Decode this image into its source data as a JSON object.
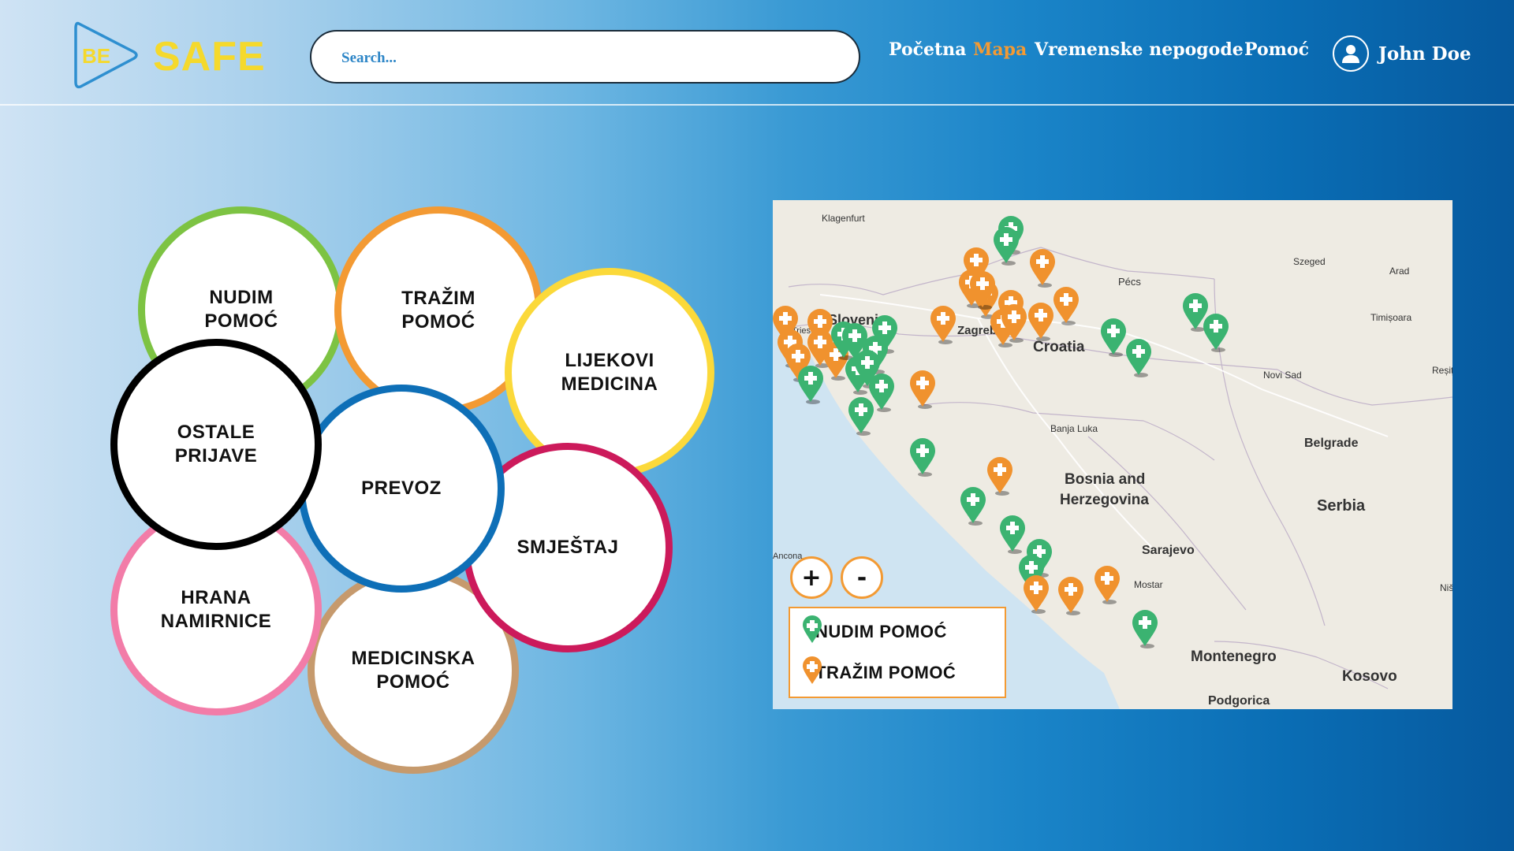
{
  "app": {
    "logo_small": "BE",
    "logo_big": "SAFE"
  },
  "search": {
    "placeholder": "Search..."
  },
  "nav": {
    "items": [
      {
        "label": "Početna",
        "active": false
      },
      {
        "label": "Mapa",
        "active": true
      },
      {
        "label": "Vremenske nepogode",
        "active": false
      },
      {
        "label": "Pomoć",
        "active": false
      }
    ]
  },
  "user": {
    "name": "John Doe",
    "icon": "user-icon"
  },
  "categories": [
    {
      "label": "NUDIM\nPOMOĆ",
      "color": "#7dc343"
    },
    {
      "label": "TRAŽIM\nPOMOĆ",
      "color": "#f39a33"
    },
    {
      "label": "LIJEKOVI\nMEDICINA",
      "color": "#fbd93a"
    },
    {
      "label": "OSTALE\nPRIJAVE",
      "color": "#000000"
    },
    {
      "label": "PREVOZ",
      "color": "#0e6fb7"
    },
    {
      "label": "SMJEŠTAJ",
      "color": "#cc1a5b"
    },
    {
      "label": "HRANA\nNAMIRNICE",
      "color": "#f27ca8"
    },
    {
      "label": "MEDICINSKA\nPOMOĆ",
      "color": "#c69a6d"
    }
  ],
  "map": {
    "place_labels": [
      "Klagenfurt",
      "Slovenia",
      "Trieste",
      "Zagreb",
      "Croatia",
      "Pécs",
      "Szeged",
      "Arad",
      "Timișoara",
      "Novi Sad",
      "Reșița",
      "Belgrade",
      "Banja Luka",
      "Bosnia and",
      "Herzegovina",
      "Serbia",
      "Sarajevo",
      "Ancona",
      "Mostar",
      "Montenegro",
      "Kosovo",
      "Podgorica",
      "Niš"
    ],
    "zoom_in": "+",
    "zoom_out": "-",
    "legend": [
      {
        "label": "NUDIM POMOĆ",
        "color": "#3bb371",
        "icon": "green-marker-icon"
      },
      {
        "label": "TRAŽIM POMOĆ",
        "color": "#f0922e",
        "icon": "orange-marker-icon"
      }
    ]
  }
}
